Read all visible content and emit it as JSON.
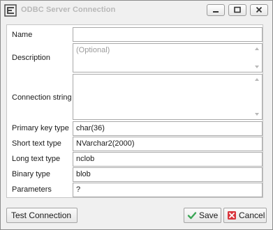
{
  "window": {
    "title": "ODBC Server Connection",
    "icon": "odbc-app-icon",
    "controls": [
      "minimize-icon",
      "maximize-icon",
      "close-icon"
    ]
  },
  "form": {
    "name": {
      "label": "Name",
      "value": ""
    },
    "description": {
      "label": "Description",
      "value": "",
      "placeholder": "(Optional)"
    },
    "connection_string": {
      "label": "Connection string",
      "value": ""
    },
    "primary_key_type": {
      "label": "Primary key type",
      "value": "char(36)"
    },
    "short_text_type": {
      "label": "Short text type",
      "value": "NVarchar2(2000)"
    },
    "long_text_type": {
      "label": "Long text type",
      "value": "nclob"
    },
    "binary_type": {
      "label": "Binary type",
      "value": "blob"
    },
    "parameters": {
      "label": "Parameters",
      "value": "?"
    }
  },
  "buttons": {
    "test_connection": "Test Connection",
    "save": "Save",
    "cancel": "Cancel"
  },
  "colors": {
    "save_check": "#3aa655",
    "cancel_x": "#d9363e",
    "title_text": "#b8b8b8"
  }
}
